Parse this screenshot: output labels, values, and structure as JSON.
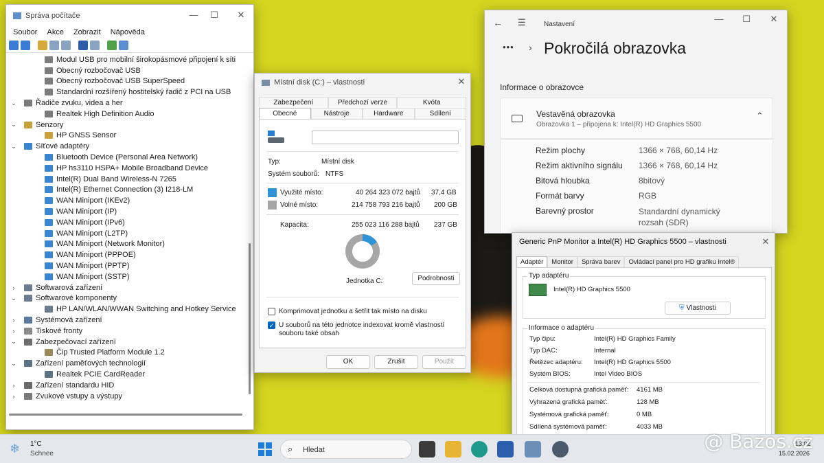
{
  "device_manager": {
    "title": "Správa počítače",
    "menu": [
      "Soubor",
      "Akce",
      "Zobrazit",
      "Nápověda"
    ],
    "tree": [
      {
        "label": "Modul USB pro mobilní širokopásmové připojení k síti",
        "level": 2,
        "icon": "usb-icon"
      },
      {
        "label": "Obecný rozbočovač USB",
        "level": 2,
        "icon": "usb-icon"
      },
      {
        "label": "Obecný rozbočovač USB SuperSpeed",
        "level": 2,
        "icon": "usb-icon"
      },
      {
        "label": "Standardní rozšířený hostitelský řadič z PCI na USB",
        "level": 2,
        "icon": "usb-icon"
      },
      {
        "label": "Řadiče zvuku, videa a her",
        "level": 1,
        "icon": "speaker-icon",
        "expanded": true
      },
      {
        "label": "Realtek High Definition Audio",
        "level": 2,
        "icon": "speaker-icon"
      },
      {
        "label": "Senzory",
        "level": 1,
        "icon": "sensor-icon",
        "expanded": true
      },
      {
        "label": "HP GNSS Sensor",
        "level": 2,
        "icon": "sensor-icon"
      },
      {
        "label": "Síťové adaptéry",
        "level": 1,
        "icon": "network-icon",
        "expanded": true
      },
      {
        "label": "Bluetooth Device (Personal Area Network)",
        "level": 2,
        "icon": "network-icon"
      },
      {
        "label": "HP hs3110 HSPA+ Mobile Broadband Device",
        "level": 2,
        "icon": "network-icon"
      },
      {
        "label": "Intel(R) Dual Band Wireless-N 7265",
        "level": 2,
        "icon": "network-icon"
      },
      {
        "label": "Intel(R) Ethernet Connection (3) I218-LM",
        "level": 2,
        "icon": "network-icon"
      },
      {
        "label": "WAN Miniport (IKEv2)",
        "level": 2,
        "icon": "network-icon"
      },
      {
        "label": "WAN Miniport (IP)",
        "level": 2,
        "icon": "network-icon"
      },
      {
        "label": "WAN Miniport (IPv6)",
        "level": 2,
        "icon": "network-icon"
      },
      {
        "label": "WAN Miniport (L2TP)",
        "level": 2,
        "icon": "network-icon"
      },
      {
        "label": "WAN Miniport (Network Monitor)",
        "level": 2,
        "icon": "network-icon"
      },
      {
        "label": "WAN Miniport (PPPOE)",
        "level": 2,
        "icon": "network-icon"
      },
      {
        "label": "WAN Miniport (PPTP)",
        "level": 2,
        "icon": "network-icon"
      },
      {
        "label": "WAN Miniport (SSTP)",
        "level": 2,
        "icon": "network-icon"
      },
      {
        "label": "Softwarová zařízení",
        "level": 1,
        "icon": "software-icon",
        "expanded": false
      },
      {
        "label": "Softwarové komponenty",
        "level": 1,
        "icon": "software-icon",
        "expanded": true
      },
      {
        "label": "HP LAN/WLAN/WWAN Switching and Hotkey Service",
        "level": 2,
        "icon": "software-icon"
      },
      {
        "label": "Systémová zařízení",
        "level": 1,
        "icon": "system-icon",
        "expanded": false
      },
      {
        "label": "Tiskové fronty",
        "level": 1,
        "icon": "printer-icon",
        "expanded": false
      },
      {
        "label": "Zabezpečovací zařízení",
        "level": 1,
        "icon": "security-icon",
        "expanded": true
      },
      {
        "label": "Čip Trusted Platform Module 1.2",
        "level": 2,
        "icon": "chip-icon"
      },
      {
        "label": "Zařízení paměťových technologií",
        "level": 1,
        "icon": "memory-icon",
        "expanded": true
      },
      {
        "label": "Realtek PCIE CardReader",
        "level": 2,
        "icon": "memory-icon"
      },
      {
        "label": "Zařízení standardu HID",
        "level": 1,
        "icon": "hid-icon",
        "expanded": false
      },
      {
        "label": "Zvukové vstupy a výstupy",
        "level": 1,
        "icon": "speaker-icon",
        "expanded": false
      }
    ]
  },
  "disk_props": {
    "title": "Místní disk (C:) – vlastnosti",
    "tabs_row1": [
      "Zabezpečení",
      "Předchozí verze",
      "Kvóta"
    ],
    "tabs_row2": [
      "Obecné",
      "Nástroje",
      "Hardware",
      "Sdílení"
    ],
    "type_label": "Typ:",
    "type_value": "Místní disk",
    "fs_label": "Systém souborů:",
    "fs_value": "NTFS",
    "used_label": "Využité místo:",
    "used_bytes": "40 264 323 072 bajtů",
    "used_gb": "37,4 GB",
    "free_label": "Volné místo:",
    "free_bytes": "214 758 793 216 bajtů",
    "free_gb": "200 GB",
    "cap_label": "Kapacita:",
    "cap_bytes": "255 023 116 288 bajtů",
    "cap_gb": "237 GB",
    "used_fraction": 0.158,
    "drive_label": "Jednotka C:",
    "details_button": "Podrobnosti",
    "compress_label": "Komprimovat jednotku a šetřit tak místo na disku",
    "index_label": "U souborů na této jednotce indexovat kromě vlastností souboru také obsah",
    "ok": "OK",
    "cancel": "Zrušit",
    "apply": "Použít",
    "used_color": "#2f93d8",
    "free_color": "#a6a6a6"
  },
  "settings": {
    "app": "Nastavení",
    "breadcrumb_dots": "•••",
    "title": "Pokročilá obrazovka",
    "section": "Informace o obrazovce",
    "display_name": "Vestavěná obrazovka",
    "display_sub": "Obrazovka 1 – připojena k: Intel(R) HD Graphics 5500",
    "rows": [
      {
        "k": "Režim plochy",
        "v": "1366 × 768, 60,14 Hz"
      },
      {
        "k": "Režim aktivního signálu",
        "v": "1366 × 768, 60,14 Hz"
      },
      {
        "k": "Bitová hloubka",
        "v": "8bitový"
      },
      {
        "k": "Formát barvy",
        "v": "RGB"
      },
      {
        "k": "Barevný prostor",
        "v": "Standardní dynamický"
      }
    ],
    "color_space_line2": "rozsah (SDR)"
  },
  "adapter": {
    "title": "Generic PnP Monitor a Intel(R) HD Graphics 5500 – vlastnosti",
    "tabs": [
      "Adaptér",
      "Monitor",
      "Správa barev",
      "Ovládací panel pro HD grafiku Intel®"
    ],
    "type_group": "Typ adaptéru",
    "adapter_name": "Intel(R) HD Graphics 5500",
    "props_button": "Vlastnosti",
    "info_group": "Informace o adaptéru",
    "info": [
      {
        "k": "Typ čipu:",
        "v": "Intel(R) HD Graphics Family"
      },
      {
        "k": "Typ DAC:",
        "v": "Internal"
      },
      {
        "k": "Řetězec adaptéru:",
        "v": "Intel(R) HD Graphics 5500"
      },
      {
        "k": "Systém BIOS:",
        "v": "Intel Video BIOS"
      }
    ],
    "memory": [
      {
        "k": "Celková dostupná grafická paměť:",
        "v": "4161 MB"
      },
      {
        "k": "Vyhrazená grafická paměť:",
        "v": "128 MB"
      },
      {
        "k": "Systémová grafická paměť:",
        "v": "0 MB"
      },
      {
        "k": "Sdílená systémová paměť:",
        "v": "4033 MB"
      }
    ]
  },
  "taskbar": {
    "temp": "1°C",
    "weather": "Schnee",
    "search": "Hledat",
    "time": "13:02",
    "date": "15.02.2026"
  },
  "watermark": "@ Bazos.cz"
}
